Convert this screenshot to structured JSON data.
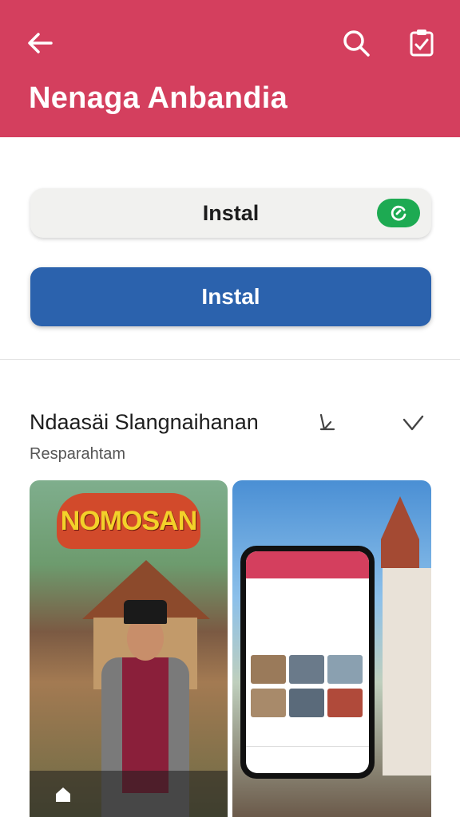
{
  "app_bar": {
    "title": "Nenaga Anbandia",
    "color": "#d43f5e"
  },
  "actions": {
    "install_secondary_label": "Instal",
    "install_primary_label": "Instal"
  },
  "section": {
    "title": "Ndaasäi Slangnaihanan",
    "subtitle": "Resparahtam"
  },
  "screenshots": {
    "first": {
      "banner_text": "NOMOSAN"
    }
  },
  "icons": [
    "back-arrow-icon",
    "search-icon",
    "clipboard-check-icon",
    "check-icon",
    "edit-icon",
    "chevron-down-icon",
    "home-icon"
  ]
}
